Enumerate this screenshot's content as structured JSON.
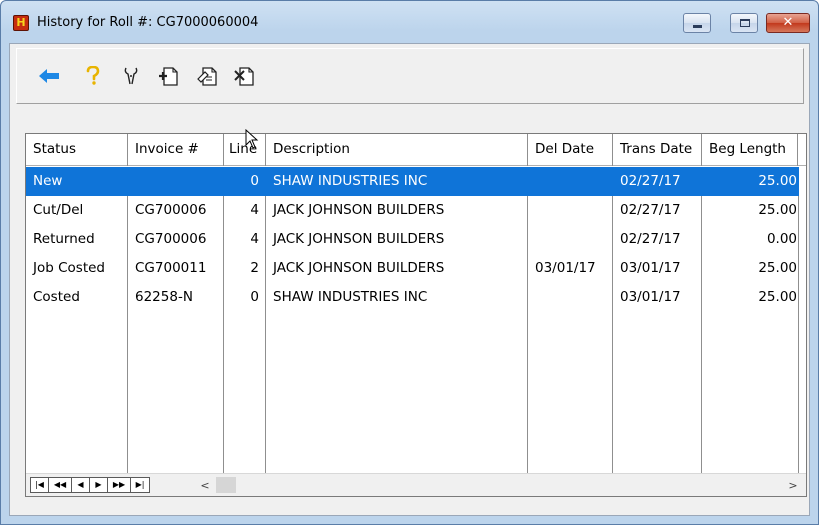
{
  "window": {
    "title": "History for Roll #: CG7000060004",
    "app_icon_letter": "H",
    "controls": [
      "minimize",
      "maximize",
      "close"
    ]
  },
  "toolbar": {
    "buttons": [
      {
        "name": "back",
        "icon": "back-arrow-icon",
        "color": "#1e88e5"
      },
      {
        "name": "help",
        "icon": "question-icon",
        "color": "#e8b400"
      },
      {
        "name": "tools",
        "icon": "tools-icon"
      },
      {
        "name": "add",
        "icon": "add-document-icon"
      },
      {
        "name": "edit",
        "icon": "edit-document-icon"
      },
      {
        "name": "delete",
        "icon": "delete-document-icon"
      }
    ]
  },
  "grid": {
    "columns": [
      "Status",
      "Invoice #",
      "Line",
      "Description",
      "Del Date",
      "Trans Date",
      "Beg Length"
    ],
    "rows": [
      {
        "status": "New",
        "invoice": "",
        "line": "0",
        "description": "SHAW INDUSTRIES INC",
        "del_date": "",
        "trans_date": "02/27/17",
        "beg_length": "25.00",
        "selected": true
      },
      {
        "status": "Cut/Del",
        "invoice": "CG700006",
        "line": "4",
        "description": "JACK JOHNSON BUILDERS",
        "del_date": "",
        "trans_date": "02/27/17",
        "beg_length": "25.00",
        "selected": false
      },
      {
        "status": "Returned",
        "invoice": "CG700006",
        "line": "4",
        "description": "JACK JOHNSON BUILDERS",
        "del_date": "",
        "trans_date": "02/27/17",
        "beg_length": "0.00",
        "selected": false
      },
      {
        "status": "Job Costed",
        "invoice": "CG700011",
        "line": "2",
        "description": "JACK JOHNSON BUILDERS",
        "del_date": "03/01/17",
        "trans_date": "03/01/17",
        "beg_length": "25.00",
        "selected": false
      },
      {
        "status": "Costed",
        "invoice": "62258-N",
        "line": "0",
        "description": "SHAW INDUSTRIES INC",
        "del_date": "",
        "trans_date": "03/01/17",
        "beg_length": "25.00",
        "selected": false
      }
    ],
    "selection_color": "#0f74d8"
  },
  "navigator": {
    "buttons": [
      "first",
      "previous-page",
      "previous",
      "next",
      "next-page",
      "last"
    ]
  }
}
